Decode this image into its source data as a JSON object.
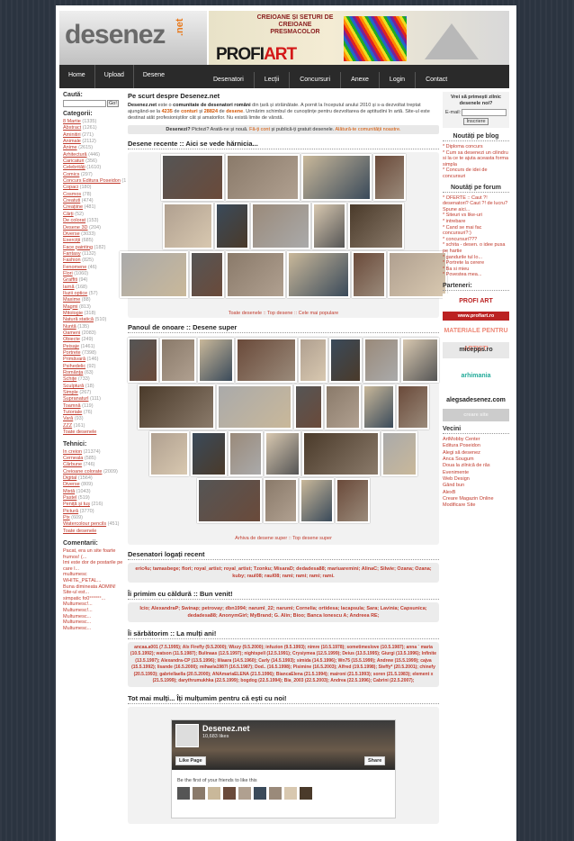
{
  "header": {
    "logo": "desenez",
    "logo_tld": ".net",
    "banner_slogan": "CREIOANE ȘI SETURI DE CREIOANE PRESMACOLOR",
    "banner_brand_a": "PROFI",
    "banner_brand_b": "ART"
  },
  "nav": {
    "row1": [
      "Home",
      "Upload",
      "Desene"
    ],
    "row2": [
      "Desenatori",
      "Lecții",
      "Concursuri",
      "Anexe",
      "Login",
      "Contact"
    ]
  },
  "left": {
    "search_title": "Caută:",
    "go": "Go!",
    "cat_title": "Categorii:",
    "categories": [
      [
        "8 Martie",
        "(1335)"
      ],
      [
        "Abstract",
        "(1261)"
      ],
      [
        "Aminitiri",
        "(271)"
      ],
      [
        "Animale",
        "(2112)"
      ],
      [
        "Anime",
        "(2615)"
      ],
      [
        "Arhitectură",
        "(446)"
      ],
      [
        "Caricaturi",
        "(356)"
      ],
      [
        "Celebrități",
        "(1610)"
      ],
      [
        "Comics",
        "(297)"
      ],
      [
        "Concurs Editura Poseidon",
        "(158)"
      ],
      [
        "Copaci",
        "(180)"
      ],
      [
        "Cosmos",
        "(78)"
      ],
      [
        "Creatuti",
        "(474)"
      ],
      [
        "Creațiine",
        "(481)"
      ],
      [
        "Cărți",
        "(52)"
      ],
      [
        "De colorat",
        "(153)"
      ],
      [
        "Desene 3D",
        "(204)"
      ],
      [
        "Diverse",
        "(3033)"
      ],
      [
        "Exerciții",
        "(685)"
      ],
      [
        "Face painting",
        "(182)"
      ],
      [
        "Fantasy",
        "(1132)"
      ],
      [
        "Fashion",
        "(825)"
      ],
      [
        "Fenomene",
        "(46)"
      ],
      [
        "Flori",
        "(1060)"
      ],
      [
        "Graffiti",
        "(94)"
      ],
      [
        "Iarnă",
        "(168)"
      ],
      [
        "Iluzii optice",
        "(57)"
      ],
      [
        "Maxime",
        "(88)"
      ],
      [
        "Magmi",
        "(813)"
      ],
      [
        "Mitologie",
        "(318)"
      ],
      [
        "Natură statică",
        "(510)"
      ],
      [
        "Nuntă",
        "(135)"
      ],
      [
        "Oameni",
        "(2083)"
      ],
      [
        "Obiecte",
        "(249)"
      ],
      [
        "Peisaje",
        "(1461)"
      ],
      [
        "Portrete",
        "(7398)"
      ],
      [
        "Primăvară",
        "(146)"
      ],
      [
        "Psihedelic",
        "(92)"
      ],
      [
        "Românța",
        "(63)"
      ],
      [
        "Schițe",
        "(733)"
      ],
      [
        "Sculptură",
        "(18)"
      ],
      [
        "Simple",
        "(267)"
      ],
      [
        "Supranaturl",
        "(111)"
      ],
      [
        "Toamnă",
        "(119)"
      ],
      [
        "Tutoriale",
        "(76)"
      ],
      [
        "Vară",
        "(93)"
      ],
      [
        "ZZZ",
        "(161)"
      ],
      [
        "Toate desenele",
        ""
      ]
    ],
    "tech_title": "Tehnici:",
    "techniques": [
      [
        "În creion",
        "(21374)"
      ],
      [
        "Cerneala",
        "(585)"
      ],
      [
        "Cărbune",
        "(746)"
      ],
      [
        "Creioane colorate",
        "(2009)"
      ],
      [
        "Digital",
        "(1564)"
      ],
      [
        "Diverse",
        "(809)"
      ],
      [
        "Mixtă",
        "(1043)"
      ],
      [
        "Pastel",
        "(519)"
      ],
      [
        "Peniță și tuș",
        "(216)"
      ],
      [
        "Pictură",
        "(3770)"
      ],
      [
        "Pix",
        "(609)"
      ],
      [
        "Watercolour pencils",
        "(451)"
      ],
      [
        "Toate desenele",
        ""
      ]
    ],
    "comm_title": "Comentarii:",
    "comments": [
      "Pacat, era un site foarte frumos! (...",
      "Imi este dor de postarile pe care l...",
      "multumesc WHITE_PETAL...",
      "Buna dimineata ADMIN! Site-ul est...",
      "simpatic fo0°°°°°°...",
      "Multumesc!...",
      "Multumesc!...",
      "Multumesc...",
      "Multumesc...",
      "Multumesc..."
    ]
  },
  "center": {
    "about_title": "Pe scurt despre Desenez.net",
    "about_text_a": "Desenez.net",
    "about_text_b": " este o ",
    "about_text_c": "comunitate de desenatori români",
    "about_text_d": " din țară și străinătate. A pornit la începutul anului 2010 și s-a dezvoltat treptat ajungând-se la ",
    "count_a": "4235",
    "about_text_e": " de ",
    "cont_a": "conturi",
    "about_text_f": " și ",
    "count_b": "28824",
    "about_text_g": " de ",
    "cont_b": "desene",
    "about_text_h": ". Urmărim schimbul de cunoștințe pentru dezvoltarea de aptitudini în artă. Site-ul este destinat atât profesioniștilor cât și amatorilor. Nu există limite de vârstă.",
    "cta_a": "Desenezi?",
    "cta_b": " Pictezi? Arată-ne și nouă. ",
    "cta_c": "Fă-ți cont",
    "cta_d": " și publică-ți gratuit desenele. ",
    "cta_e": "Alătură-te comunității noastre.",
    "recent_title": "Desene recente :: Aici se vede hărnicia...",
    "recent_caption": "Toate desenele :: Top desene :: Cele mai populare",
    "honor_title": "Panoul de onoare :: Desene super",
    "honor_caption": "Arhiva de desene super :: Top desene super",
    "logged_title": "Desenatori logați recent",
    "logged_users": "eric4u; tamasbege; flori; royal_artist; royal_artist; Tzonku; MisaraD; dedadesa88; mariuaremini; AlinaC; Silwie; Ozana; Ozana; kuby; raul08; raul08; rami; rami; rami; rami.",
    "welcome_title": "Îi primim cu căldură :: Bun venit!",
    "welcome_users": "Icio; AlexandraP; Swinap; petrovay; dbn1994; naruml_22; narumi; Cornelia; ortidesa; lacapsula; Sara; Lavinia; Capsunica; dedadesa88; AnonymGirl; MyBrand; G. Alin; Bioo; Banca Ionescu A; Andreea RE;",
    "bday_title": "Îi sărbătorim :: La mulți ani!",
    "bday_text": "ancaa.a001 (7.5.1995); Alx Firefly (9.5.2000); Wizzy (9.5.2000); infuzion (9.5.1993); nimre (10.5.1978); sometimeslove (10.5.1987); anna ` maria (10.5.1992); watson (11.5.1987); Bulinaas (12.5.1997); nightspell (12.5.1991); Crysiymea (12.5.1999); Deius (13.5.1995); Giurgi (13.5.1996); Infinite (13.5.1997); Alexandra-CP (13.5.1996); liliaara (14.5.1960); Carly (14.5.1993); simida (14.5.1996); Wn75 (15.5.1999); Andrew (15.5.1999); cajva (15.5.1992); lisande (16.5.2000); mihaela1987l (16.5.1987); Dod.. (16.5.1998); Pisimine (16.5.2003); Alfred (19.5.1998); Steffy* (20.5.2001); chinefy (20.5.1993); gabriellaella (20.5.2000); ANAmariaELENA (21.5.1996); BiancaElena (21.5.1994); maironi (21.5.1993); soren (21.5.1983); element x (21.5.1999); darythrumukhka (22.5.1999); bogdog (22.5.1994); Bia_2003 (22.5.2003); Andrea (22.5.1996); Cabrini (22.5.2007);",
    "thanks_title": "Tot mai mulți... Îți mulțumim pentru că ești cu noi!",
    "fb_name": "Desenez.net",
    "fb_likes": "10,683 likes",
    "fb_like": "Like Page",
    "fb_share": "Share",
    "fb_friends": "Be the first of your friends to like this"
  },
  "right": {
    "news_q": "Vrei să primești zilnic desenele noi?",
    "email_label": "E-mail:",
    "subscribe": "Înscriere",
    "blog_title": "Noutăți pe blog",
    "blog": [
      "* Diploma concurs",
      "* Cum sa desenezi un cilindru si la ce te ajuta aceasta forma simpla",
      "* Concurs de idei de concursuri"
    ],
    "forum_title": "Noutăți pe forum",
    "forum": [
      "* OFERTE :: Caut ?! desenatori? Caut ?! de lucru? Spune aici...",
      "* Siteuri vs like-uri",
      "* intrebare",
      "* Cand se mai fac concursuri?:)",
      "* concursuri???",
      "* schita - desen. o idee pusa pe hartie",
      "* gandurile tul lo...",
      "* Portrete la cerere",
      "* Ba si mieu",
      "* Povestea mea..."
    ],
    "partners_title": "Parteneri:",
    "partners": [
      "PROFI ART",
      "www.profiart.ro",
      "MATERIALE PENTRU ARTIȘTI",
      "micepps.ro",
      "arhimania",
      "alegsadesenez.com",
      "creare site"
    ],
    "links_title": "Vecini",
    "links": [
      "ArtMobby Center",
      "Editura Poseidon",
      "Alegi să desenez",
      "Anca Sougum",
      "Doua la zilnică de râs",
      "Evenimente",
      "Web Design",
      "Gând bun",
      "AlexB",
      "Creare Magazin Online",
      "Modificare Site"
    ]
  },
  "colors": {
    "accent": "#c0392b",
    "nav_bg": "#2a2a2a",
    "page_bg": "#2b3440"
  }
}
